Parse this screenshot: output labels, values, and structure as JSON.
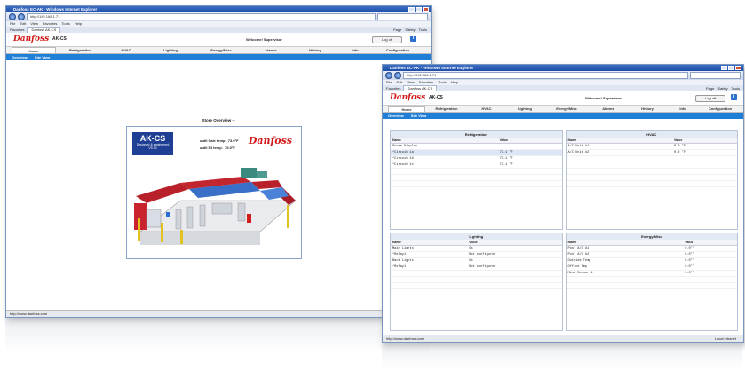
{
  "browser": {
    "title": "Danfoss EC-AK - Windows Internet Explorer",
    "url": "http://192.168.1.71",
    "menus": [
      "File",
      "Edit",
      "View",
      "Favorites",
      "Tools",
      "Help"
    ],
    "favorites_label": "Favorites",
    "tab_title": "Danfoss AK-CS",
    "toolbar_items": [
      "Page",
      "Safety",
      "Tools"
    ]
  },
  "app": {
    "brand": "Danfoss",
    "product": "AK-CS",
    "welcome": "Welcome! Supervisor",
    "logoff": "Log off",
    "info": "i",
    "nav_tabs": [
      "Home",
      "Refrigeration",
      "HVAC",
      "Lighting",
      "Energy/Misc",
      "Alarms",
      "History",
      "Info",
      "Configuration"
    ],
    "active_tab": "Home",
    "subnav_1": [
      "Overview",
      "Site View"
    ],
    "subnav_2": [
      "Overview",
      "Site View"
    ],
    "statusbar_left": "http://www.danfoss.com",
    "statusbar_zone": "Local intranet"
  },
  "overview": {
    "title": "Store Overview --",
    "badge_big": "AK-CS",
    "badge_small_1": "Designed & engineered",
    "badge_small_2": "V5.33",
    "outside_temp_label": "outli Sale temp.",
    "outside_temp_value": "73.0°F",
    "outside_rh_label": "outli 54 temp.",
    "outside_rh_value": "75.0°F",
    "logo": "Danfoss"
  },
  "panels": {
    "refrigeration": {
      "title": "Refrigeration",
      "columns": [
        "Name",
        "Value"
      ],
      "rows": [
        [
          "Store Display",
          ""
        ],
        [
          "  *Circuit 1a",
          "73.1 °F"
        ],
        [
          "  *Circuit 1b",
          "73.1 °F"
        ],
        [
          "  *Circuit 1c",
          "73.1 °F"
        ]
      ]
    },
    "hvac": {
      "title": "HVAC",
      "columns": [
        "Name",
        "Value"
      ],
      "rows": [
        [
          "A/C Unit #1",
          "0.0 °F"
        ],
        [
          "A/C Unit #2",
          "0.0 °F"
        ]
      ]
    },
    "lighting": {
      "title": "Lighting",
      "columns": [
        "Name",
        "Value"
      ],
      "rows": [
        [
          "Main Lights",
          "On"
        ],
        [
          "  *Relay1",
          "Not configured"
        ],
        [
          "Back Lights",
          "On"
        ],
        [
          "  *Relay1",
          "Not configured"
        ]
      ]
    },
    "energy": {
      "title": "Energy/Misc",
      "columns": [
        "Name",
        "Value"
      ],
      "rows": [
        [
          "Pool A/C #1",
          "0.0°F"
        ],
        [
          "Pool A/C #2",
          "0.0°F"
        ],
        [
          "Outside Temp",
          "0.0°F"
        ],
        [
          "Office Tmp",
          "0.0°F"
        ],
        [
          "Misc Sensor 1",
          "0.0°F"
        ]
      ]
    }
  },
  "colors": {
    "accent_blue": "#1f7fd6",
    "brand_red": "#d21a1a",
    "badge_blue": "#1e3f94"
  }
}
